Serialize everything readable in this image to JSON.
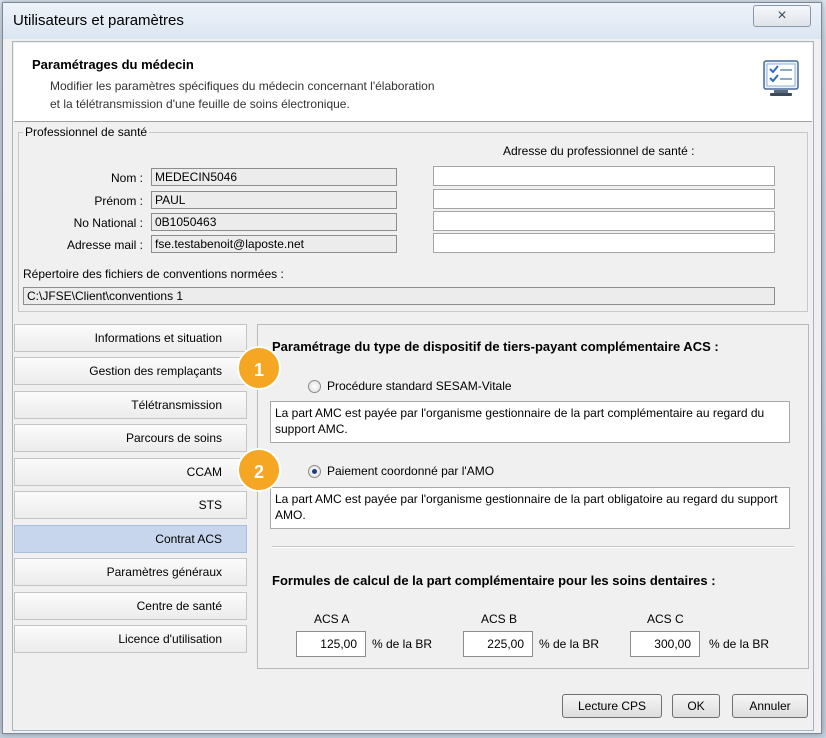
{
  "window": {
    "title": "Utilisateurs et paramètres",
    "close_icon": "×"
  },
  "header": {
    "title": "Paramétrages du médecin",
    "desc_line1": "Modifier les paramètres spécifiques du médecin concernant l'élaboration",
    "desc_line2": "et la télétransmission d'une feuille de soins électronique."
  },
  "professional": {
    "group_label": "Professionnel de santé",
    "address_label": "Adresse du professionnel de santé :",
    "nom_label": "Nom :",
    "nom_value": "MEDECIN5046",
    "prenom_label": "Prénom :",
    "prenom_value": "PAUL",
    "no_national_label": "No National :",
    "no_national_value": "0B1050463",
    "email_label": "Adresse mail :",
    "email_value": "fse.testabenoit@laposte.net",
    "address_lines": [
      "",
      "",
      "",
      ""
    ],
    "repertoire_label": "Répertoire des fichiers de conventions normées :",
    "repertoire_value": "C:\\JFSE\\Client\\conventions  1"
  },
  "nav": [
    {
      "label": "Informations et situation"
    },
    {
      "label": "Gestion des remplaçants"
    },
    {
      "label": "Télétransmission"
    },
    {
      "label": "Parcours de soins"
    },
    {
      "label": "CCAM"
    },
    {
      "label": "STS"
    },
    {
      "label": "Contrat ACS"
    },
    {
      "label": "Paramètres généraux"
    },
    {
      "label": "Centre de santé"
    },
    {
      "label": "Licence d'utilisation"
    }
  ],
  "active_nav": "Contrat ACS",
  "acs": {
    "title": "Paramétrage du type de dispositif de tiers-payant complémentaire ACS :",
    "option1_label": "Procédure standard SESAM-Vitale",
    "option1_desc": "La part AMC est payée par l'organisme gestionnaire de la part complémentaire au regard du support AMC.",
    "option1_checked": false,
    "option2_label": "Paiement coordonné par l'AMO",
    "option2_desc": "La part AMC est payée par l'organisme gestionnaire de la part obligatoire au regard du support AMO.",
    "option2_checked": true,
    "formula_title": "Formules de calcul de la part complémentaire pour les soins dentaires  :",
    "acs_a_label": "ACS A",
    "acs_a_value": "125,00",
    "acs_b_label": "ACS B",
    "acs_b_value": "225,00",
    "acs_c_label": "ACS C",
    "acs_c_value": "300,00",
    "unit": "% de la BR"
  },
  "badges": {
    "one": "1",
    "two": "2"
  },
  "buttons": {
    "lecture": "Lecture CPS",
    "ok": "OK",
    "cancel": "Annuler"
  },
  "colors": {
    "active_nav": "#c7d6ec",
    "badge": "#f5a623"
  }
}
